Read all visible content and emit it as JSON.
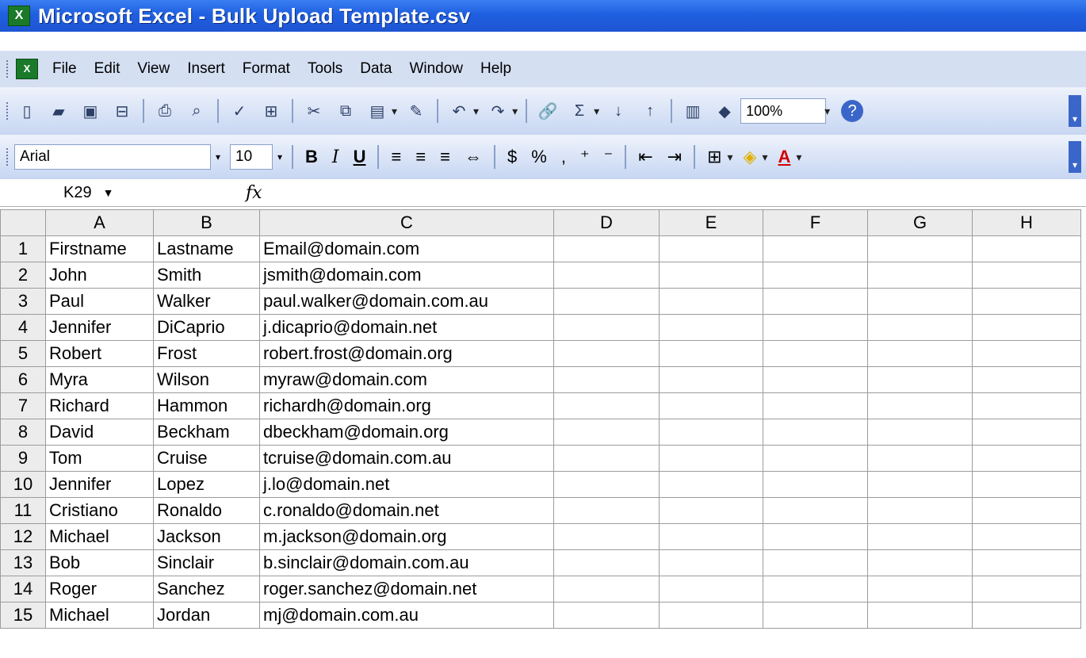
{
  "app": {
    "icon": "excel-icon",
    "title": "Microsoft Excel - Bulk Upload Template.csv"
  },
  "menu": [
    "File",
    "Edit",
    "View",
    "Insert",
    "Format",
    "Tools",
    "Data",
    "Window",
    "Help"
  ],
  "toolbar": {
    "zoom": "100%",
    "font": "Arial",
    "font_size": "10"
  },
  "formula_bar": {
    "name_box": "K29",
    "fx": "fx"
  },
  "sheet": {
    "columns": [
      "A",
      "B",
      "C",
      "D",
      "E",
      "F",
      "G",
      "H"
    ],
    "rows": [
      {
        "n": "1",
        "a": "Firstname",
        "b": "Lastname",
        "c": "Email@domain.com"
      },
      {
        "n": "2",
        "a": "John",
        "b": "Smith",
        "c": "jsmith@domain.com"
      },
      {
        "n": "3",
        "a": "Paul",
        "b": "Walker",
        "c": "paul.walker@domain.com.au"
      },
      {
        "n": "4",
        "a": "Jennifer",
        "b": "DiCaprio",
        "c": "j.dicaprio@domain.net"
      },
      {
        "n": "5",
        "a": "Robert",
        "b": "Frost",
        "c": "robert.frost@domain.org"
      },
      {
        "n": "6",
        "a": "Myra",
        "b": "Wilson",
        "c": "myraw@domain.com"
      },
      {
        "n": "7",
        "a": "Richard",
        "b": "Hammon",
        "c": "richardh@domain.org"
      },
      {
        "n": "8",
        "a": "David",
        "b": "Beckham",
        "c": "dbeckham@domain.org"
      },
      {
        "n": "9",
        "a": "Tom",
        "b": "Cruise",
        "c": "tcruise@domain.com.au"
      },
      {
        "n": "10",
        "a": "Jennifer",
        "b": "Lopez",
        "c": "j.lo@domain.net"
      },
      {
        "n": "11",
        "a": "Cristiano",
        "b": "Ronaldo",
        "c": "c.ronaldo@domain.net"
      },
      {
        "n": "12",
        "a": "Michael",
        "b": "Jackson",
        "c": "m.jackson@domain.org"
      },
      {
        "n": "13",
        "a": "Bob",
        "b": "Sinclair",
        "c": "b.sinclair@domain.com.au"
      },
      {
        "n": "14",
        "a": "Roger",
        "b": "Sanchez",
        "c": "roger.sanchez@domain.net"
      },
      {
        "n": "15",
        "a": "Michael",
        "b": "Jordan",
        "c": "mj@domain.com.au"
      }
    ]
  },
  "colors": {
    "titlebar": "#1f5fe0",
    "toolbar": "#c7d6f2",
    "header_bg": "#ececec"
  }
}
